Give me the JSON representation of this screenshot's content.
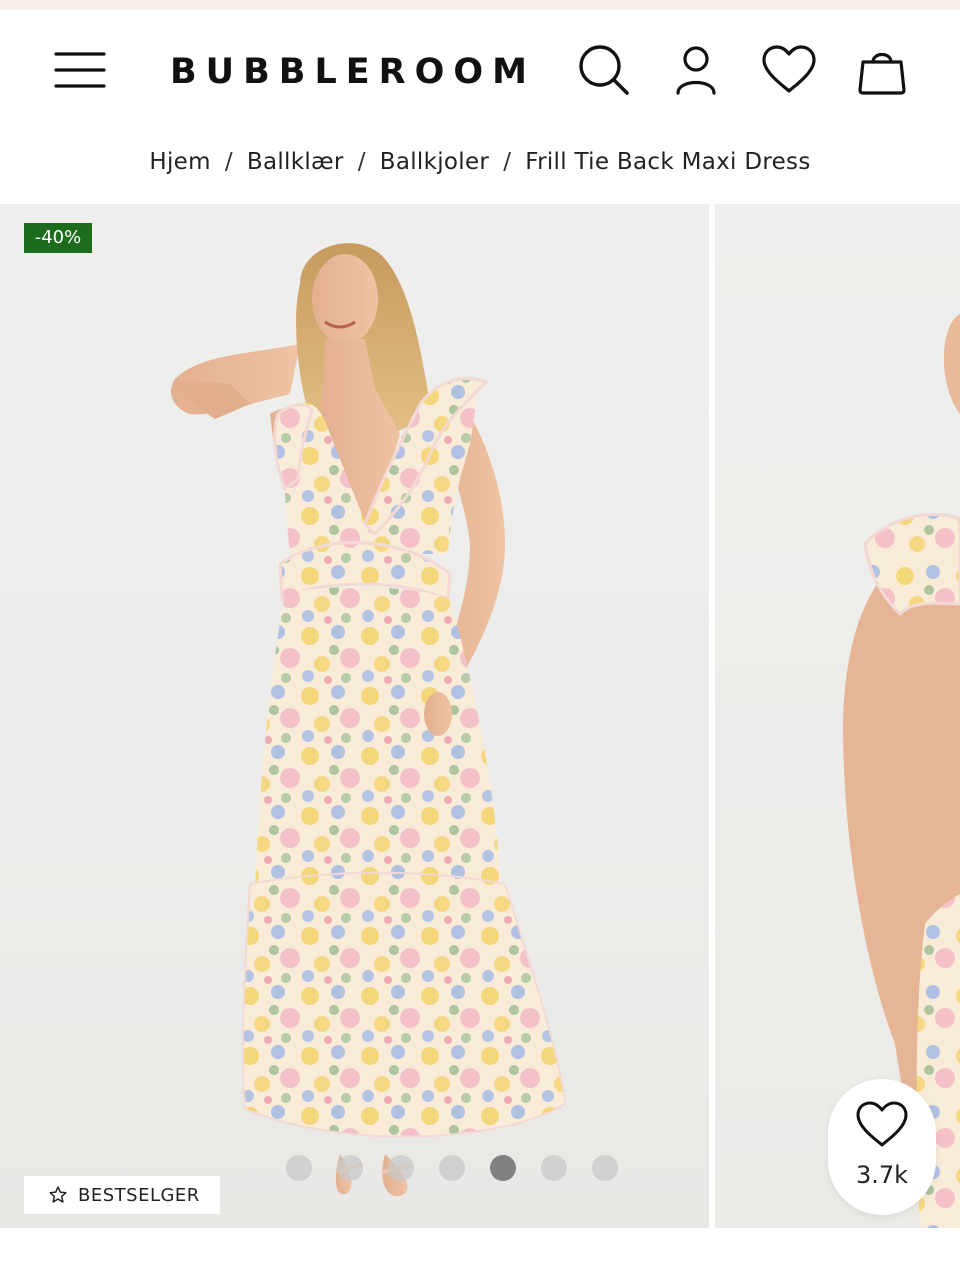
{
  "header": {
    "logo": "BUBBLEROOM",
    "icons": {
      "menu": "menu-icon",
      "search": "search-icon",
      "account": "user-icon",
      "wishlist": "heart-icon",
      "bag": "shopping-bag-icon"
    }
  },
  "breadcrumb": {
    "items": [
      "Hjem",
      "Ballklær",
      "Ballkjoler",
      "Frill Tie Back Maxi Dress"
    ],
    "separator": "/"
  },
  "gallery": {
    "discount_badge": "-40%",
    "bestseller_label": "BESTSELGER",
    "dots_total": 7,
    "active_dot": 4,
    "favorites_count": "3.7k"
  },
  "colors": {
    "discount_badge_bg": "#1d6b1c",
    "top_strip": "#f7f0ea",
    "dress_pattern": [
      "#f4d36b",
      "#9fb6e6",
      "#f2b3c4",
      "#8fb585",
      "#f8ecd8"
    ]
  }
}
